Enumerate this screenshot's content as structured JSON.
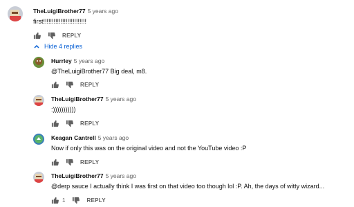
{
  "comments": [
    {
      "author": "TheLuigiBrother77",
      "time": "5 years ago",
      "text": "first!!!!!!!!!!!!!!!!!!!!!!!!!",
      "likes": "",
      "reply_label": "REPLY"
    },
    {
      "author": "Hurrley",
      "time": "5 years ago",
      "text": "@TheLuigiBrother77 Big deal, m8.",
      "likes": "",
      "reply_label": "REPLY"
    },
    {
      "author": "TheLuigiBrother77",
      "time": "5 years ago",
      "text": ":)))))))))))",
      "likes": "",
      "reply_label": "REPLY"
    },
    {
      "author": "Keagan Cantrell",
      "time": "5 years ago",
      "text": "Now if only this was on the original video and not the YouTube video :P",
      "likes": "",
      "reply_label": "REPLY"
    },
    {
      "author": "TheLuigiBrother77",
      "time": "5 years ago",
      "text": "@derp sauce I actually think I was first on that video too though lol :P. Ah, the days of witty wizard...",
      "likes": "1",
      "reply_label": "REPLY"
    }
  ],
  "hide_replies_label": "Hide 4 replies",
  "icons": {
    "like": "thumbs-up-icon",
    "dislike": "thumbs-down-icon",
    "toggle": "chevron-up-icon"
  },
  "colors": {
    "link": "#065fd4",
    "meta": "#606060",
    "text": "#0f0f0f"
  }
}
